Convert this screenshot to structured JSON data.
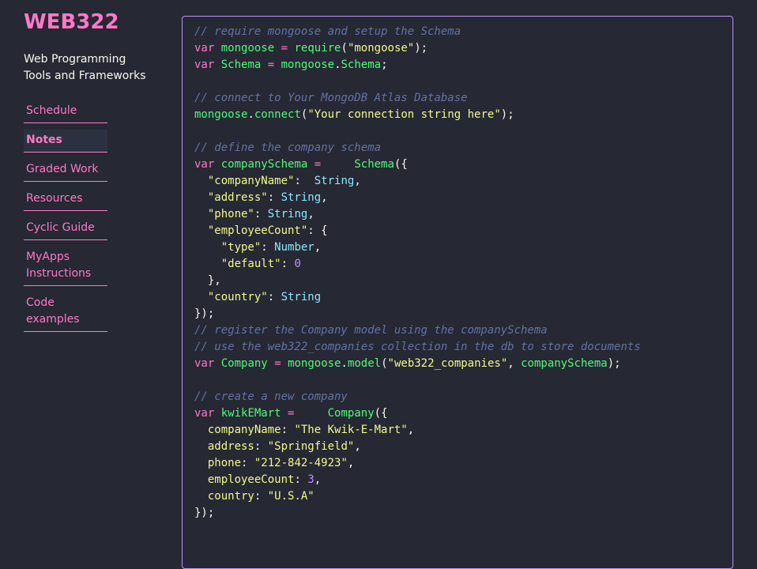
{
  "sidebar": {
    "title": "WEB322",
    "subtitle_line1": "Web Programming",
    "subtitle_line2": "Tools and Frameworks",
    "nav": [
      {
        "label": "Schedule",
        "active": false
      },
      {
        "label": "Notes",
        "active": true
      },
      {
        "label": "Graded Work",
        "active": false
      },
      {
        "label": "Resources",
        "active": false
      },
      {
        "label": "Cyclic Guide",
        "active": false
      },
      {
        "label": "MyApps Instructions",
        "active": false
      },
      {
        "label": "Code examples",
        "active": false
      }
    ]
  },
  "colors": {
    "accent": "#ff79c6",
    "comment": "#6272a4",
    "function": "#50fa7b",
    "string": "#f1fa8c",
    "type": "#8be9fd",
    "number": "#bd93f9",
    "border": "#bd93f9",
    "background": "#262833"
  },
  "code": {
    "lines": [
      [
        [
          "c",
          "// require mongoose and setup the Schema"
        ]
      ],
      [
        [
          "k",
          "var"
        ],
        [
          "p",
          " "
        ],
        [
          "f",
          "mongoose"
        ],
        [
          "p",
          " "
        ],
        [
          "k",
          "="
        ],
        [
          "p",
          " "
        ],
        [
          "f",
          "require"
        ],
        [
          "p",
          "("
        ],
        [
          "s",
          "\"mongoose\""
        ],
        [
          "p",
          ");"
        ]
      ],
      [
        [
          "k",
          "var"
        ],
        [
          "p",
          " "
        ],
        [
          "f",
          "Schema"
        ],
        [
          "p",
          " "
        ],
        [
          "k",
          "="
        ],
        [
          "p",
          " "
        ],
        [
          "f",
          "mongoose"
        ],
        [
          "p",
          "."
        ],
        [
          "f",
          "Schema"
        ],
        [
          "p",
          ";"
        ]
      ],
      [],
      [
        [
          "c",
          "// connect to Your MongoDB Atlas Database"
        ]
      ],
      [
        [
          "f",
          "mongoose"
        ],
        [
          "p",
          "."
        ],
        [
          "f",
          "connect"
        ],
        [
          "p",
          "("
        ],
        [
          "s",
          "\"Your connection string here\""
        ],
        [
          "p",
          ");"
        ]
      ],
      [],
      [
        [
          "c",
          "// define the company schema"
        ]
      ],
      [
        [
          "k",
          "var"
        ],
        [
          "p",
          " "
        ],
        [
          "f",
          "companySchema"
        ],
        [
          "p",
          " "
        ],
        [
          "k",
          "="
        ],
        [
          "p",
          "     "
        ],
        [
          "f",
          "Schema"
        ],
        [
          "p",
          "({"
        ]
      ],
      [
        [
          "p",
          "  "
        ],
        [
          "s",
          "\"companyName\""
        ],
        [
          "p",
          ":  "
        ],
        [
          "t",
          "String"
        ],
        [
          "p",
          ","
        ]
      ],
      [
        [
          "p",
          "  "
        ],
        [
          "s",
          "\"address\""
        ],
        [
          "p",
          ": "
        ],
        [
          "t",
          "String"
        ],
        [
          "p",
          ","
        ]
      ],
      [
        [
          "p",
          "  "
        ],
        [
          "s",
          "\"phone\""
        ],
        [
          "p",
          ": "
        ],
        [
          "t",
          "String"
        ],
        [
          "p",
          ","
        ]
      ],
      [
        [
          "p",
          "  "
        ],
        [
          "s",
          "\"employeeCount\""
        ],
        [
          "p",
          ": {"
        ]
      ],
      [
        [
          "p",
          "    "
        ],
        [
          "s",
          "\"type\""
        ],
        [
          "p",
          ": "
        ],
        [
          "t",
          "Number"
        ],
        [
          "p",
          ","
        ]
      ],
      [
        [
          "p",
          "    "
        ],
        [
          "s",
          "\"default\""
        ],
        [
          "p",
          ": "
        ],
        [
          "n",
          "0"
        ]
      ],
      [
        [
          "p",
          "  },"
        ]
      ],
      [
        [
          "p",
          "  "
        ],
        [
          "s",
          "\"country\""
        ],
        [
          "p",
          ": "
        ],
        [
          "t",
          "String"
        ]
      ],
      [
        [
          "p",
          "});"
        ]
      ],
      [
        [
          "c",
          "// register the Company model using the companySchema"
        ]
      ],
      [
        [
          "c",
          "// use the web322_companies collection in the db to store documents"
        ]
      ],
      [
        [
          "k",
          "var"
        ],
        [
          "p",
          " "
        ],
        [
          "f",
          "Company"
        ],
        [
          "p",
          " "
        ],
        [
          "k",
          "="
        ],
        [
          "p",
          " "
        ],
        [
          "f",
          "mongoose"
        ],
        [
          "p",
          "."
        ],
        [
          "f",
          "model"
        ],
        [
          "p",
          "("
        ],
        [
          "s",
          "\"web322_companies\""
        ],
        [
          "p",
          ", "
        ],
        [
          "f",
          "companySchema"
        ],
        [
          "p",
          ");"
        ]
      ],
      [],
      [
        [
          "c",
          "// create a new company"
        ]
      ],
      [
        [
          "k",
          "var"
        ],
        [
          "p",
          " "
        ],
        [
          "f",
          "kwikEMart"
        ],
        [
          "p",
          " "
        ],
        [
          "k",
          "="
        ],
        [
          "p",
          "     "
        ],
        [
          "f",
          "Company"
        ],
        [
          "p",
          "({"
        ]
      ],
      [
        [
          "p",
          "  "
        ],
        [
          "y",
          "companyName"
        ],
        [
          "p",
          ": "
        ],
        [
          "s",
          "\"The Kwik-E-Mart\""
        ],
        [
          "p",
          ","
        ]
      ],
      [
        [
          "p",
          "  "
        ],
        [
          "y",
          "address"
        ],
        [
          "p",
          ": "
        ],
        [
          "s",
          "\"Springfield\""
        ],
        [
          "p",
          ","
        ]
      ],
      [
        [
          "p",
          "  "
        ],
        [
          "y",
          "phone"
        ],
        [
          "p",
          ": "
        ],
        [
          "s",
          "\"212-842-4923\""
        ],
        [
          "p",
          ","
        ]
      ],
      [
        [
          "p",
          "  "
        ],
        [
          "y",
          "employeeCount"
        ],
        [
          "p",
          ": "
        ],
        [
          "n",
          "3"
        ],
        [
          "p",
          ","
        ]
      ],
      [
        [
          "p",
          "  "
        ],
        [
          "y",
          "country"
        ],
        [
          "p",
          ": "
        ],
        [
          "s",
          "\"U.S.A\""
        ]
      ],
      [
        [
          "p",
          "});"
        ]
      ]
    ]
  }
}
